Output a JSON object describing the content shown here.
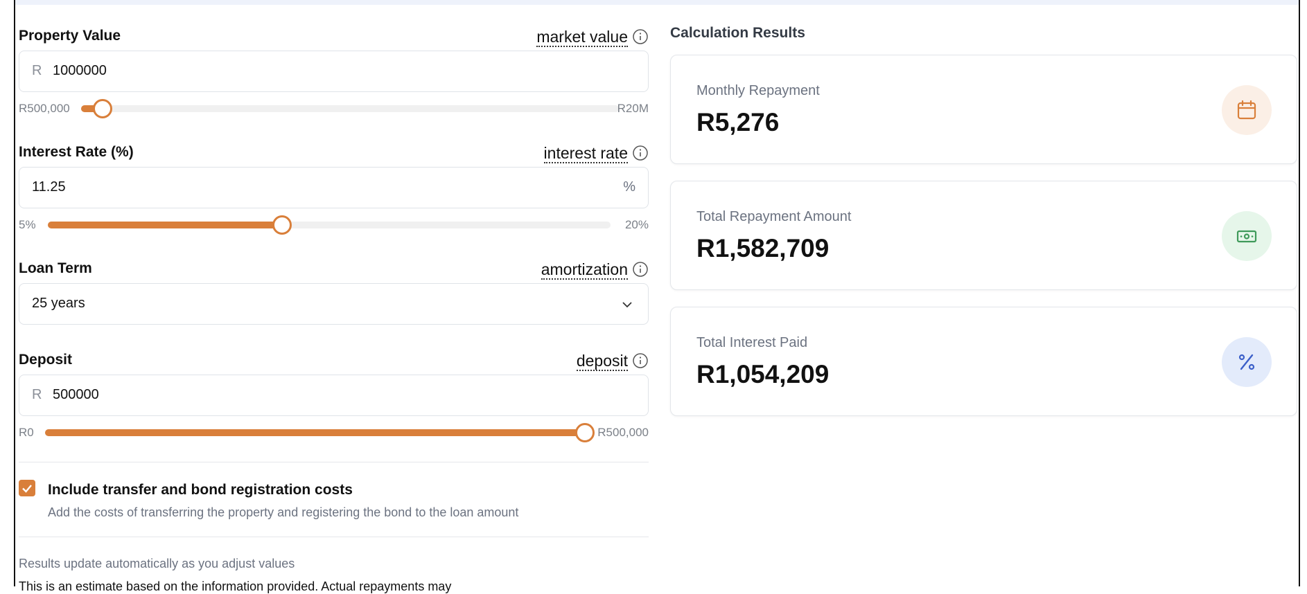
{
  "form": {
    "property_value": {
      "label": "Property Value",
      "term": "market value",
      "prefix": "R",
      "value": "1000000",
      "min_label": "R500,000",
      "max_label": "R20M",
      "slider_level": 0.04
    },
    "interest_rate": {
      "label": "Interest Rate (%)",
      "term": "interest rate",
      "value": "11.25",
      "suffix": "%",
      "min_label": "5%",
      "max_label": "20%",
      "slider_level": 0.4167
    },
    "loan_term": {
      "label": "Loan Term",
      "term": "amortization",
      "value": "25 years"
    },
    "deposit": {
      "label": "Deposit",
      "term": "deposit",
      "prefix": "R",
      "value": "500000",
      "min_label": "R0",
      "max_label": "R500,000",
      "slider_level": 1.0
    },
    "include_costs": {
      "checked": true,
      "title": "Include transfer and bond registration costs",
      "subtitle": "Add the costs of transferring the property and registering the bond to the loan amount"
    },
    "note": "Results update automatically as you adjust values",
    "note_partial": "This is an estimate based on the information provided. Actual repayments may"
  },
  "results": {
    "title": "Calculation Results",
    "cards": [
      {
        "label": "Monthly Repayment",
        "value": "R5,276",
        "icon": "calendar-icon",
        "icon_color": "#d97f3a",
        "icon_bg": "#fbefe6"
      },
      {
        "label": "Total Repayment Amount",
        "value": "R1,582,709",
        "icon": "banknote-icon",
        "icon_color": "#3f9a5a",
        "icon_bg": "#e6f6ea"
      },
      {
        "label": "Total Interest Paid",
        "value": "R1,054,209",
        "icon": "percent-icon",
        "icon_color": "#3b5fc9",
        "icon_bg": "#e3ebfb"
      }
    ]
  },
  "colors": {
    "accent": "#d97f3a",
    "track": "#f0f0f0",
    "border": "#dfe3e8"
  }
}
